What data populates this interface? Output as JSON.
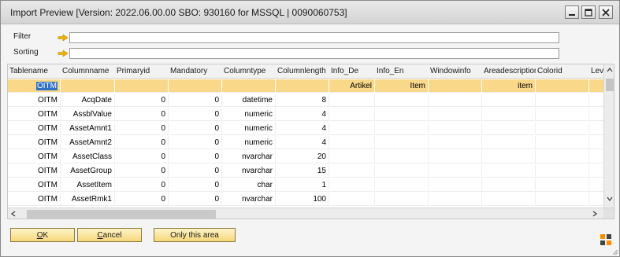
{
  "window": {
    "title": "Import Preview [Version: 2022.06.00.00 SBO: 930160 for MSSQL | 0090060753]",
    "controls": [
      "minimize-icon",
      "maximize-icon",
      "close-icon"
    ]
  },
  "filter": {
    "label": "Filter",
    "value": "",
    "arrow_icon": "link-arrow-icon"
  },
  "sorting": {
    "label": "Sorting",
    "value": "",
    "arrow_icon": "link-arrow-icon"
  },
  "grid": {
    "columns": [
      "Tablename",
      "Columnname",
      "Primaryid",
      "Mandatory",
      "Columntype",
      "Columnlength",
      "Info_De",
      "Info_En",
      "Windowinfo",
      "Areadescription",
      "Colorid",
      "Lev"
    ],
    "rows": [
      [
        "OITM",
        "",
        "",
        "",
        "",
        "",
        "Artikel",
        "Item",
        "",
        "item",
        "",
        ""
      ],
      [
        "OITM",
        "AcqDate",
        "0",
        "0",
        "datetime",
        "8",
        "",
        "",
        "",
        "",
        "",
        ""
      ],
      [
        "OITM",
        "AssblValue",
        "0",
        "0",
        "numeric",
        "4",
        "",
        "",
        "",
        "",
        "",
        ""
      ],
      [
        "OITM",
        "AssetAmnt1",
        "0",
        "0",
        "numeric",
        "4",
        "",
        "",
        "",
        "",
        "",
        ""
      ],
      [
        "OITM",
        "AssetAmnt2",
        "0",
        "0",
        "numeric",
        "4",
        "",
        "",
        "",
        "",
        "",
        ""
      ],
      [
        "OITM",
        "AssetClass",
        "0",
        "0",
        "nvarchar",
        "20",
        "",
        "",
        "",
        "",
        "",
        ""
      ],
      [
        "OITM",
        "AssetGroup",
        "0",
        "0",
        "nvarchar",
        "15",
        "",
        "",
        "",
        "",
        "",
        ""
      ],
      [
        "OITM",
        "AssetItem",
        "0",
        "0",
        "char",
        "1",
        "",
        "",
        "",
        "",
        "",
        ""
      ],
      [
        "OITM",
        "AssetRmk1",
        "0",
        "0",
        "nvarchar",
        "100",
        "",
        "",
        "",
        "",
        "",
        ""
      ]
    ],
    "selected_row": 0,
    "scroll_icons": [
      "chevron-up-icon",
      "chevron-down-icon",
      "chevron-left-icon",
      "chevron-right-icon"
    ]
  },
  "buttons": {
    "ok": {
      "mnemonic": "O",
      "rest": "K"
    },
    "cancel": {
      "mnemonic": "C",
      "rest": "ancel"
    },
    "only_area": "Only this area"
  },
  "colors": {
    "selected_row": "#fad88a",
    "selected_cell": "#3271c8",
    "button_gold": "#f6d77a",
    "link_arrow": "#f0b400"
  }
}
